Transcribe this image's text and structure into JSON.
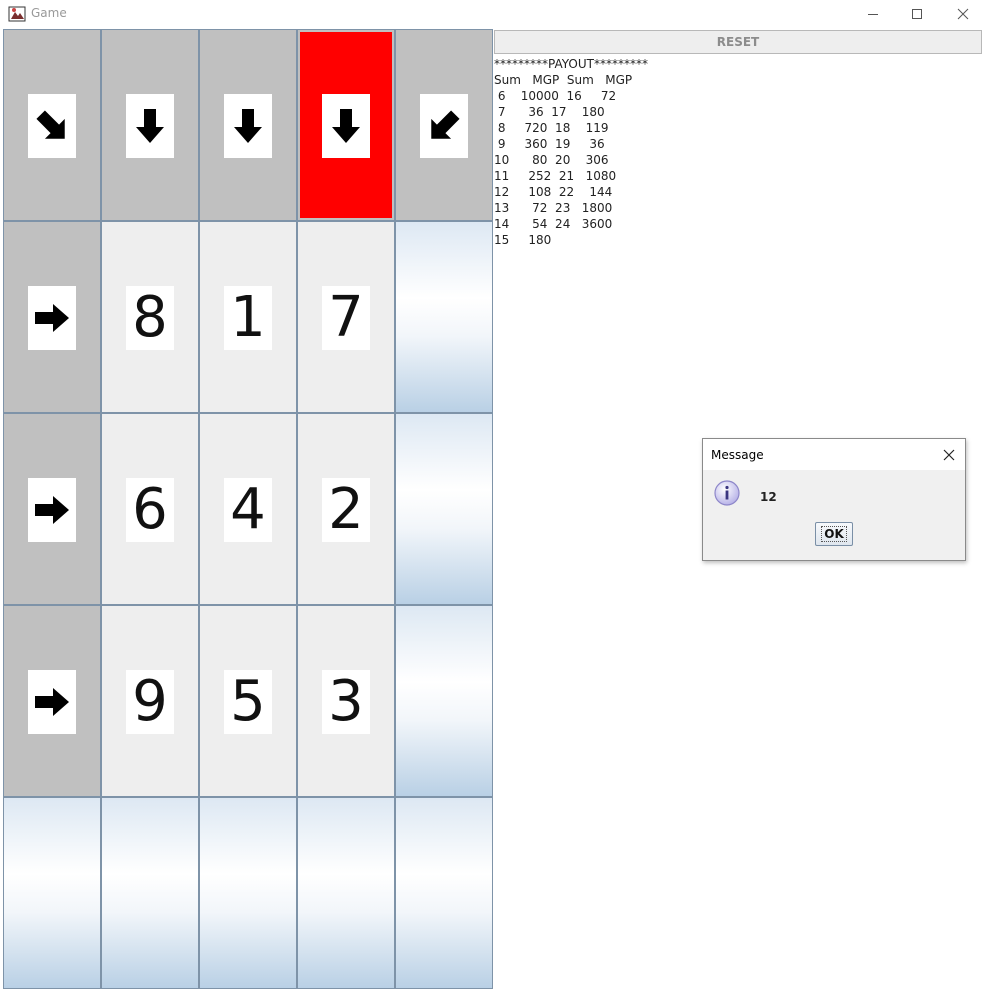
{
  "window": {
    "title": "Game"
  },
  "grid": {
    "header_arrows": [
      "arrow-down-right-icon",
      "arrow-down-icon",
      "arrow-down-icon",
      "arrow-down-icon",
      "arrow-down-left-icon"
    ],
    "selected_header_column": 4,
    "selected_color": "#ff0000",
    "row_arrows": [
      "arrow-right-icon",
      "arrow-right-icon",
      "arrow-right-icon"
    ],
    "numbers": [
      [
        "8",
        "1",
        "7"
      ],
      [
        "6",
        "4",
        "2"
      ],
      [
        "9",
        "5",
        "3"
      ]
    ]
  },
  "toolbar": {
    "reset_label": "RESET"
  },
  "payout": {
    "text": "*********PAYOUT*********\nSum   MGP  Sum   MGP\n 6    10000  16     72\n 7      36  17    180\n 8     720  18    119\n 9     360  19     36\n10      80  20    306\n11     252  21   1080\n12     108  22    144\n13      72  23   1800\n14      54  24   3600\n15     180"
  },
  "dialog": {
    "title": "Message",
    "message": "12",
    "ok_label": "OK"
  }
}
